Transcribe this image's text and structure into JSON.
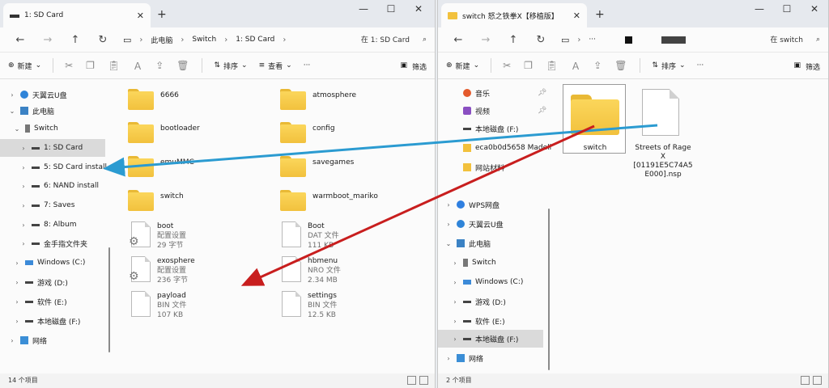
{
  "left": {
    "tab_title": "1: SD Card",
    "breadcrumbs": [
      "此电脑",
      "Switch",
      "1: SD Card"
    ],
    "search_placeholder": "在 1: SD Card",
    "toolbar": {
      "new": "新建",
      "sort": "排序",
      "view": "查看",
      "more": "···",
      "filter": "筛选"
    },
    "nav": [
      "天翼云U盘",
      "此电脑",
      "Switch",
      "1: SD Card",
      "5: SD Card install",
      "6: NAND install",
      "7: Saves",
      "8: Album",
      "金手指文件夹",
      "Windows (C:)",
      "游戏 (D:)",
      "软件 (E:)",
      "本地磁盘 (F:)",
      "网络"
    ],
    "folders": [
      "6666",
      "atmosphere",
      "bootloader",
      "config",
      "emuMMC",
      "savegames",
      "switch",
      "warmboot_mariko"
    ],
    "files": [
      {
        "name": "boot",
        "type": "配置设置",
        "size": "29 字节"
      },
      {
        "name": "Boot",
        "type": "DAT 文件",
        "size": "111 KB"
      },
      {
        "name": "exosphere",
        "type": "配置设置",
        "size": "236 字节"
      },
      {
        "name": "hbmenu",
        "type": "NRO 文件",
        "size": "2.34 MB"
      },
      {
        "name": "payload",
        "type": "BIN 文件",
        "size": "107 KB"
      },
      {
        "name": "settings",
        "type": "BIN 文件",
        "size": "12.5 KB"
      }
    ],
    "status": "14 个项目"
  },
  "right": {
    "tab_title": "switch 怒之铁拳X【移植版】",
    "breadcrumbs_more": "···",
    "search_placeholder": "在 switch",
    "toolbar": {
      "new": "新建",
      "sort": "排序",
      "more": "···",
      "filter": "筛选"
    },
    "nav": [
      "音乐",
      "视频",
      "本地磁盘 (F:)",
      "eca0b0d5658 Madell",
      "网站材料",
      "WPS网盘",
      "天翼云U盘",
      "此电脑",
      "Switch",
      "Windows (C:)",
      "游戏 (D:)",
      "软件 (E:)",
      "本地磁盘 (F:)",
      "网络"
    ],
    "items": [
      {
        "name": "switch"
      },
      {
        "name_lines": [
          "Streets of Rage",
          "X",
          "[01191E5C74A5",
          "E000].nsp"
        ]
      }
    ],
    "status": "2 个项目"
  },
  "colors": {
    "arrow_blue": "#2b9bd1",
    "arrow_red": "#c81e1e",
    "folder": "#f5c743"
  }
}
